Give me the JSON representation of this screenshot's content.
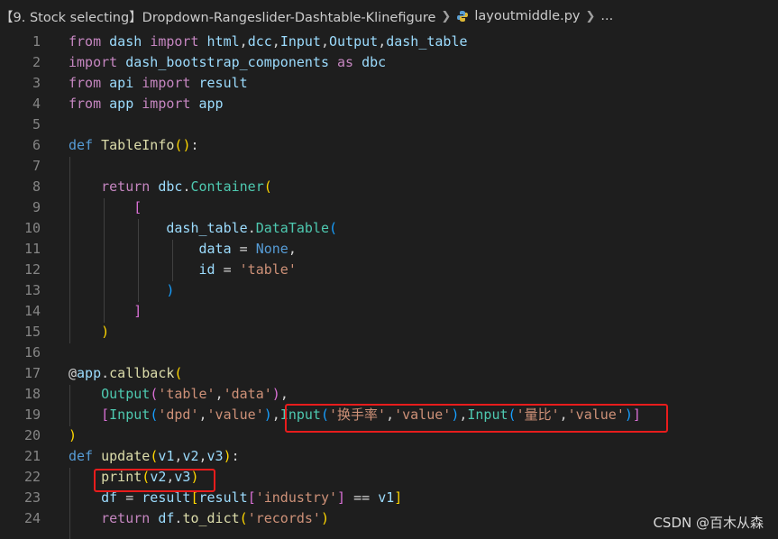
{
  "breadcrumb": {
    "folder": "【9. Stock selecting】Dropdown-Rangeslider-Dashtable-Klinefigure",
    "file": "layoutmiddle.py",
    "more": "..."
  },
  "code_lines": [
    {
      "n": "1",
      "tokens": [
        [
          "from",
          "ctl"
        ],
        [
          " dash ",
          "var"
        ],
        [
          "import",
          "ctl"
        ],
        [
          " ",
          ""
        ],
        [
          "html",
          "var"
        ],
        [
          ",",
          ""
        ],
        [
          "dcc",
          "var"
        ],
        [
          ",",
          ""
        ],
        [
          "Input",
          "var"
        ],
        [
          ",",
          ""
        ],
        [
          "Output",
          "var"
        ],
        [
          ",",
          ""
        ],
        [
          "dash_table",
          "var"
        ]
      ]
    },
    {
      "n": "2",
      "tokens": [
        [
          "import",
          "ctl"
        ],
        [
          " dash_bootstrap_components ",
          "var"
        ],
        [
          "as",
          "ctl"
        ],
        [
          " dbc",
          "var"
        ]
      ]
    },
    {
      "n": "3",
      "tokens": [
        [
          "from",
          "ctl"
        ],
        [
          " api ",
          "var"
        ],
        [
          "import",
          "ctl"
        ],
        [
          " result",
          "var"
        ]
      ]
    },
    {
      "n": "4",
      "tokens": [
        [
          "from",
          "ctl"
        ],
        [
          " app ",
          "var"
        ],
        [
          "import",
          "ctl"
        ],
        [
          " app",
          "var"
        ]
      ]
    },
    {
      "n": "5",
      "tokens": []
    },
    {
      "n": "6",
      "tokens": [
        [
          "def",
          "kw"
        ],
        [
          " ",
          ""
        ],
        [
          "TableInfo",
          "fn"
        ],
        [
          "(",
          "b1"
        ],
        [
          ")",
          "b1"
        ],
        [
          ":",
          ""
        ]
      ]
    },
    {
      "n": "7",
      "tokens": []
    },
    {
      "n": "8",
      "tokens": [
        [
          "    ",
          ""
        ],
        [
          "return",
          "ctl"
        ],
        [
          " ",
          ""
        ],
        [
          "dbc",
          "var"
        ],
        [
          ".",
          ""
        ],
        [
          "Container",
          "cls"
        ],
        [
          "(",
          "b1"
        ]
      ]
    },
    {
      "n": "9",
      "tokens": [
        [
          "        ",
          ""
        ],
        [
          "[",
          "b2"
        ]
      ]
    },
    {
      "n": "10",
      "tokens": [
        [
          "            ",
          ""
        ],
        [
          "dash_table",
          "var"
        ],
        [
          ".",
          ""
        ],
        [
          "DataTable",
          "cls"
        ],
        [
          "(",
          "b3"
        ]
      ]
    },
    {
      "n": "11",
      "tokens": [
        [
          "                ",
          ""
        ],
        [
          "data",
          "var"
        ],
        [
          " = ",
          ""
        ],
        [
          "None",
          "kw"
        ],
        [
          ",",
          ""
        ]
      ]
    },
    {
      "n": "12",
      "tokens": [
        [
          "                ",
          ""
        ],
        [
          "id",
          "var"
        ],
        [
          " = ",
          ""
        ],
        [
          "'table'",
          "str"
        ]
      ]
    },
    {
      "n": "13",
      "tokens": [
        [
          "            ",
          ""
        ],
        [
          ")",
          "b3"
        ]
      ]
    },
    {
      "n": "14",
      "tokens": [
        [
          "        ",
          ""
        ],
        [
          "]",
          "b2"
        ]
      ]
    },
    {
      "n": "15",
      "tokens": [
        [
          "    ",
          ""
        ],
        [
          ")",
          "b1"
        ]
      ]
    },
    {
      "n": "16",
      "tokens": []
    },
    {
      "n": "17",
      "tokens": [
        [
          "@",
          ""
        ],
        [
          "app",
          "var"
        ],
        [
          ".",
          ""
        ],
        [
          "callback",
          "fn"
        ],
        [
          "(",
          "b1"
        ]
      ]
    },
    {
      "n": "18",
      "tokens": [
        [
          "    ",
          ""
        ],
        [
          "Output",
          "cls"
        ],
        [
          "(",
          "b2"
        ],
        [
          "'table'",
          "str"
        ],
        [
          ",",
          ""
        ],
        [
          "'data'",
          "str"
        ],
        [
          ")",
          "b2"
        ],
        [
          ",",
          ""
        ]
      ]
    },
    {
      "n": "19",
      "tokens": [
        [
          "    ",
          ""
        ],
        [
          "[",
          "b2"
        ],
        [
          "Input",
          "cls"
        ],
        [
          "(",
          "b3"
        ],
        [
          "'dpd'",
          "str"
        ],
        [
          ",",
          ""
        ],
        [
          "'value'",
          "str"
        ],
        [
          ")",
          "b3"
        ],
        [
          ",",
          ""
        ],
        [
          "Input",
          "cls"
        ],
        [
          "(",
          "b3"
        ],
        [
          "'换手率'",
          "str"
        ],
        [
          ",",
          ""
        ],
        [
          "'value'",
          "str"
        ],
        [
          ")",
          "b3"
        ],
        [
          ",",
          ""
        ],
        [
          "Input",
          "cls"
        ],
        [
          "(",
          "b3"
        ],
        [
          "'量比'",
          "str"
        ],
        [
          ",",
          ""
        ],
        [
          "'value'",
          "str"
        ],
        [
          ")",
          "b3"
        ],
        [
          "]",
          "b2"
        ]
      ]
    },
    {
      "n": "20",
      "tokens": [
        [
          ")",
          "b1"
        ]
      ]
    },
    {
      "n": "21",
      "tokens": [
        [
          "def",
          "kw"
        ],
        [
          " ",
          ""
        ],
        [
          "update",
          "fn"
        ],
        [
          "(",
          "b1"
        ],
        [
          "v1",
          "var"
        ],
        [
          ",",
          ""
        ],
        [
          "v2",
          "var"
        ],
        [
          ",",
          ""
        ],
        [
          "v3",
          "var"
        ],
        [
          ")",
          "b1"
        ],
        [
          ":",
          ""
        ]
      ]
    },
    {
      "n": "22",
      "tokens": [
        [
          "    ",
          ""
        ],
        [
          "print",
          "fn"
        ],
        [
          "(",
          "b1"
        ],
        [
          "v2",
          "var"
        ],
        [
          ",",
          ""
        ],
        [
          "v3",
          "var"
        ],
        [
          ")",
          "b1"
        ]
      ]
    },
    {
      "n": "23",
      "tokens": [
        [
          "    ",
          ""
        ],
        [
          "df",
          "var"
        ],
        [
          " = ",
          ""
        ],
        [
          "result",
          "var"
        ],
        [
          "[",
          "b1"
        ],
        [
          "result",
          "var"
        ],
        [
          "[",
          "b2"
        ],
        [
          "'industry'",
          "str"
        ],
        [
          "]",
          "b2"
        ],
        [
          " == ",
          ""
        ],
        [
          "v1",
          "var"
        ],
        [
          "]",
          "b1"
        ]
      ]
    },
    {
      "n": "24",
      "tokens": [
        [
          "    ",
          ""
        ],
        [
          "return",
          "ctl"
        ],
        [
          " ",
          ""
        ],
        [
          "df",
          "var"
        ],
        [
          ".",
          ""
        ],
        [
          "to_dict",
          "fn"
        ],
        [
          "(",
          "b1"
        ],
        [
          "'records'",
          "str"
        ],
        [
          ")",
          "b1"
        ]
      ]
    }
  ],
  "watermark": "CSDN @百木从森"
}
